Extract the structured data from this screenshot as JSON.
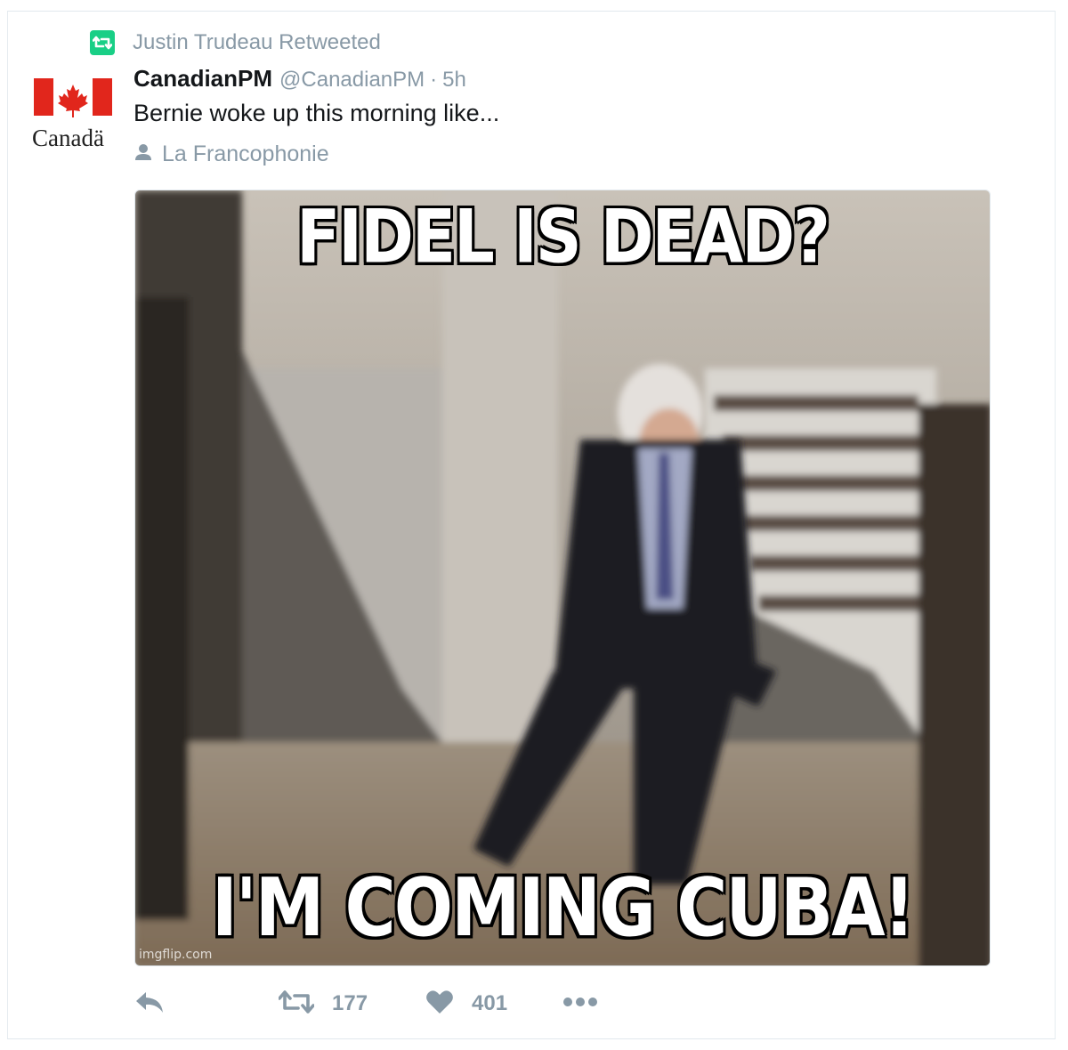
{
  "retweet_context": {
    "text": "Justin Trudeau Retweeted",
    "icon": "retweet-icon",
    "color": "#19cf86"
  },
  "author": {
    "display_name": "CanadianPM",
    "handle": "@CanadianPM",
    "separator": "·",
    "time": "5h",
    "avatar_wordmark": "Canadä"
  },
  "tweet": {
    "text": "Bernie woke up this morning like...",
    "place": "La Francophonie"
  },
  "media": {
    "top_caption": "FIDEL IS DEAD?",
    "bottom_caption": "I'M COMING CUBA!",
    "watermark": "imgflip.com"
  },
  "actions": {
    "reply_icon": "reply-icon",
    "retweet_icon": "retweet-icon",
    "retweet_count": "177",
    "like_icon": "heart-icon",
    "like_count": "401",
    "more_icon": "more-icon"
  },
  "colors": {
    "muted": "#8899a6",
    "text": "#14171a",
    "flag_red": "#e1261c"
  }
}
